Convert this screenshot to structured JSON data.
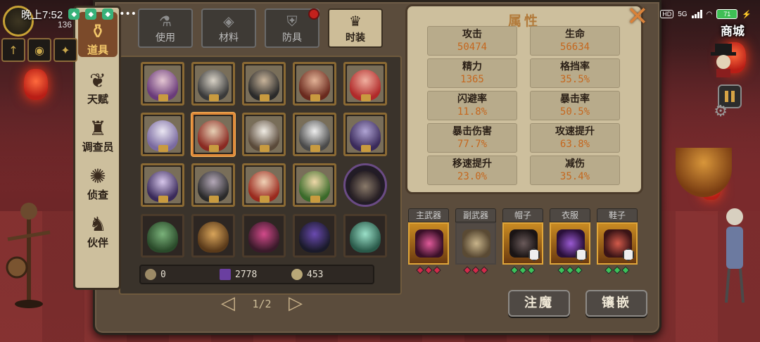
{
  "status_bar": {
    "time": "晚上7:52",
    "network": "5G",
    "hd": "HD",
    "battery": "71"
  },
  "hud": {
    "level": "136",
    "shop_label": "商城"
  },
  "side_tabs": [
    {
      "label": "道具",
      "icon": "bag-icon",
      "active": true
    },
    {
      "label": "天赋",
      "icon": "talent-icon",
      "active": false
    },
    {
      "label": "调查员",
      "icon": "investigator-icon",
      "active": false
    },
    {
      "label": "侦查",
      "icon": "scout-icon",
      "active": false
    },
    {
      "label": "伙伴",
      "icon": "companion-icon",
      "active": false
    }
  ],
  "sub_tabs": [
    {
      "label": "使用",
      "icon": "potion-icon",
      "active": false
    },
    {
      "label": "材料",
      "icon": "material-icon",
      "active": false
    },
    {
      "label": "防具",
      "icon": "armor-icon",
      "active": false
    },
    {
      "label": "时装",
      "icon": "top-hat-icon",
      "active": true
    }
  ],
  "currency": [
    {
      "value": "0",
      "icon": "stone-icon",
      "color": "#9c8a66"
    },
    {
      "value": "2778",
      "icon": "book-icon",
      "color": "#6a3fa0"
    },
    {
      "value": "453",
      "icon": "coin-icon",
      "color": "#b9a878"
    }
  ],
  "pagination": {
    "text": "1/2"
  },
  "attributes": {
    "title": "属性",
    "stats": [
      {
        "key": "攻击",
        "value": "50474"
      },
      {
        "key": "生命",
        "value": "56634"
      },
      {
        "key": "精力",
        "value": "1365"
      },
      {
        "key": "格挡率",
        "value": "35.5%"
      },
      {
        "key": "闪避率",
        "value": "11.8%"
      },
      {
        "key": "暴击率",
        "value": "50.5%"
      },
      {
        "key": "暴击伤害",
        "value": "77.7%"
      },
      {
        "key": "攻速提升",
        "value": "63.8%"
      },
      {
        "key": "移速提升",
        "value": "23.0%"
      },
      {
        "key": "减伤",
        "value": "35.4%"
      }
    ]
  },
  "equipment": [
    {
      "label": "主武器",
      "color": "#b3305e",
      "gem_color": "#d22a4a"
    },
    {
      "label": "副武器",
      "color": "#8c7a58",
      "gem_color": "#d22a4a"
    },
    {
      "label": "帽子",
      "color": "#e0a63a",
      "gem_color": "#3cc25a"
    },
    {
      "label": "衣服",
      "color": "#7a3fb0",
      "gem_color": "#3cc25a"
    },
    {
      "label": "鞋子",
      "color": "#b9434a",
      "gem_color": "#3cc25a"
    }
  ],
  "actions": {
    "enchant": "注魔",
    "inlay": "镶嵌"
  },
  "colors": {
    "accent": "#d9823a",
    "panel_bg": "#cdbf9d",
    "value_text": "#c5671e"
  }
}
